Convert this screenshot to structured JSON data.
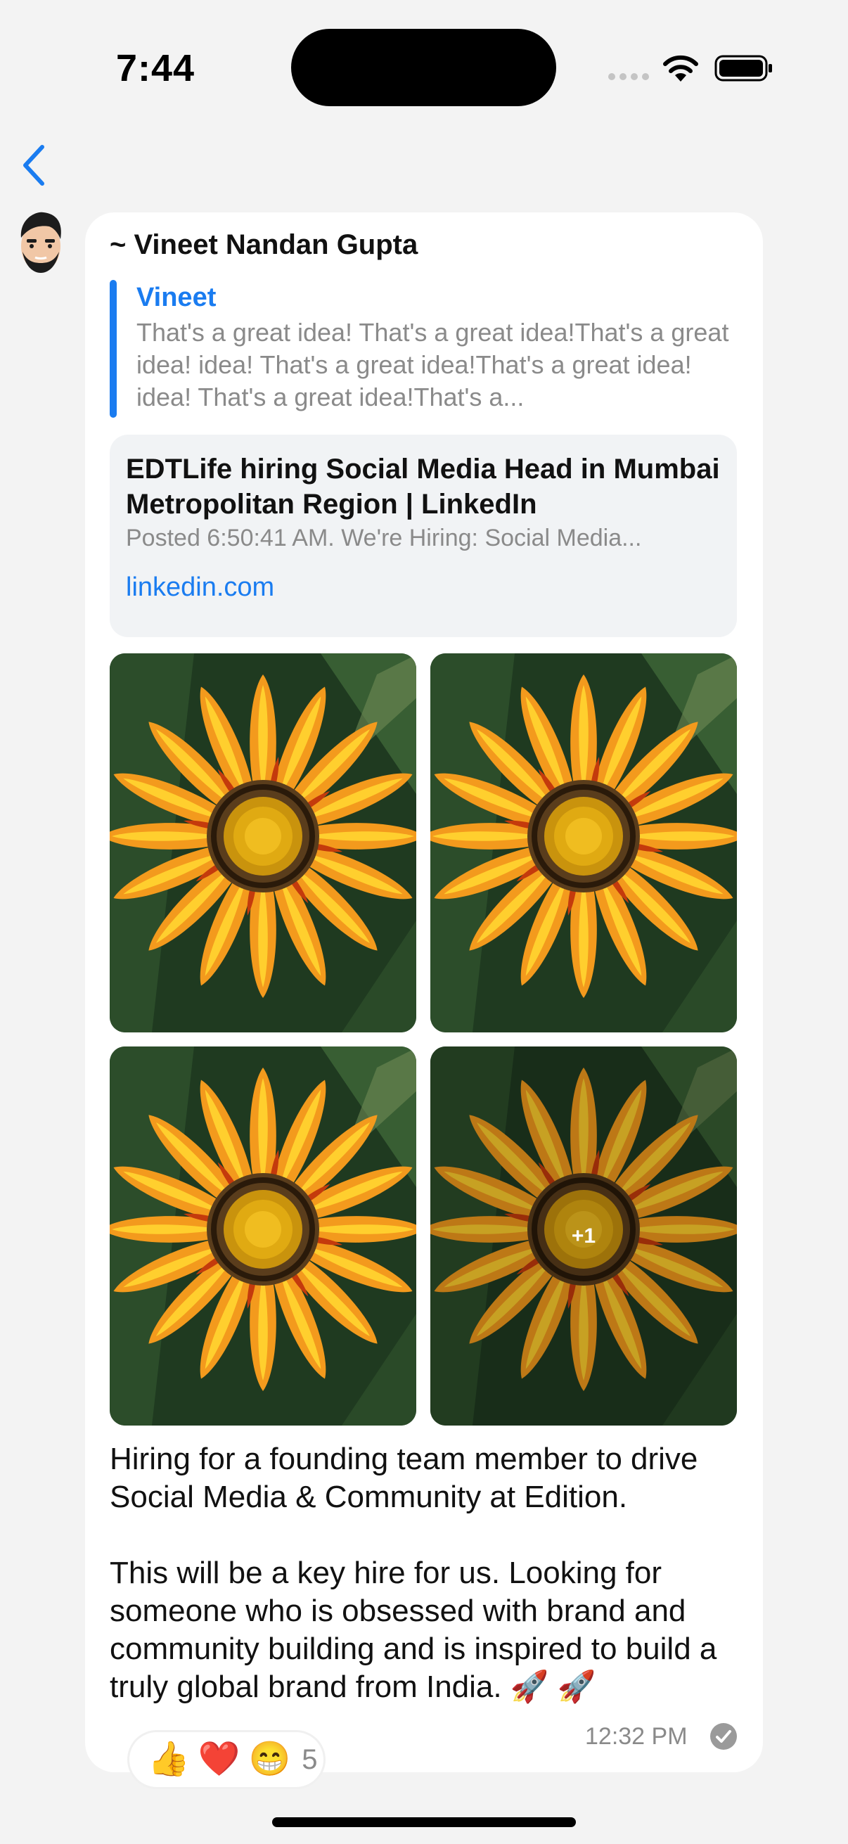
{
  "status_bar": {
    "time": "7:44"
  },
  "header": {
    "back_icon": "chevron-left-icon"
  },
  "message": {
    "sender": "~ Vineet Nandan Gupta",
    "quote": {
      "author": "Vineet",
      "text": "That's a great idea! That's a great idea!That's a great idea! idea! That's a great idea!That's a great idea! idea! That's a great idea!That's a..."
    },
    "link_preview": {
      "title": "EDTLife hiring Social Media Head in Mumbai Metropolitan Region | LinkedIn",
      "description": "Posted 6:50:41 AM. We're Hiring: Social Media...",
      "domain": "linkedin.com"
    },
    "photos": {
      "more_count": "+1"
    },
    "body": "Hiring for a founding team member to drive Social Media & Community at Edition.\n\nThis will be a key hire for us. Looking for someone who is obsessed with brand and community building and is inspired to build a truly global brand from India. 🚀 🚀",
    "timestamp": "12:32 PM",
    "reactions": {
      "emojis": [
        "👍",
        "❤️",
        "😁"
      ],
      "count": "5"
    }
  },
  "colors": {
    "accent": "#1a7cf0",
    "background": "#f3f3f3",
    "bubble": "#ffffff",
    "link_card": "#f1f3f5"
  }
}
